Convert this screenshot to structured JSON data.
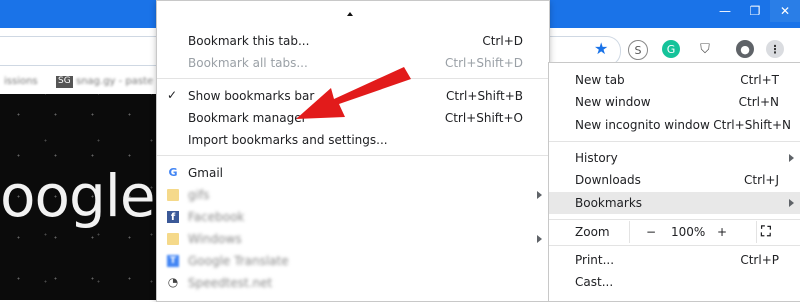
{
  "browser": {
    "window_controls": [
      "—",
      "❐",
      "✕"
    ],
    "bookmarks_bar_items": [
      "issions",
      "SG",
      "snag.gy - paste"
    ],
    "page_text": "oogle"
  },
  "bookmarks_submenu": {
    "bookmark_this_tab": {
      "label": "Bookmark this tab...",
      "shortcut": "Ctrl+D"
    },
    "bookmark_all_tabs": {
      "label": "Bookmark all tabs...",
      "shortcut": "Ctrl+Shift+D"
    },
    "show_bookmarks_bar": {
      "label": "Show bookmarks bar",
      "shortcut": "Ctrl+Shift+B",
      "checked": true
    },
    "bookmark_manager": {
      "label": "Bookmark manager",
      "shortcut": "Ctrl+Shift+O"
    },
    "import": {
      "label": "Import bookmarks and settings..."
    },
    "bookmarks": [
      {
        "label": "Gmail",
        "icon": "google-icon"
      },
      {
        "label": "gifs",
        "icon": "folder-icon",
        "has_submenu": true
      },
      {
        "label": "Facebook",
        "icon": "facebook-icon"
      },
      {
        "label": "Windows",
        "icon": "folder-icon",
        "has_submenu": true
      },
      {
        "label": "Google Translate",
        "icon": "translate-icon"
      },
      {
        "label": "Speedtest.net",
        "icon": "speedtest-icon"
      }
    ]
  },
  "chrome_menu": {
    "new_tab": {
      "label": "New tab",
      "shortcut": "Ctrl+T"
    },
    "new_window": {
      "label": "New window",
      "shortcut": "Ctrl+N"
    },
    "new_incognito": {
      "label": "New incognito window",
      "shortcut": "Ctrl+Shift+N"
    },
    "history": {
      "label": "History"
    },
    "downloads": {
      "label": "Downloads",
      "shortcut": "Ctrl+J"
    },
    "bookmarks": {
      "label": "Bookmarks"
    },
    "zoom": {
      "label": "Zoom",
      "minus": "−",
      "level": "100%",
      "plus": "+"
    },
    "print": {
      "label": "Print...",
      "shortcut": "Ctrl+P"
    },
    "cast": {
      "label": "Cast..."
    }
  },
  "colors": {
    "accent": "#1a73e8",
    "annotation": "#e21b1b"
  }
}
